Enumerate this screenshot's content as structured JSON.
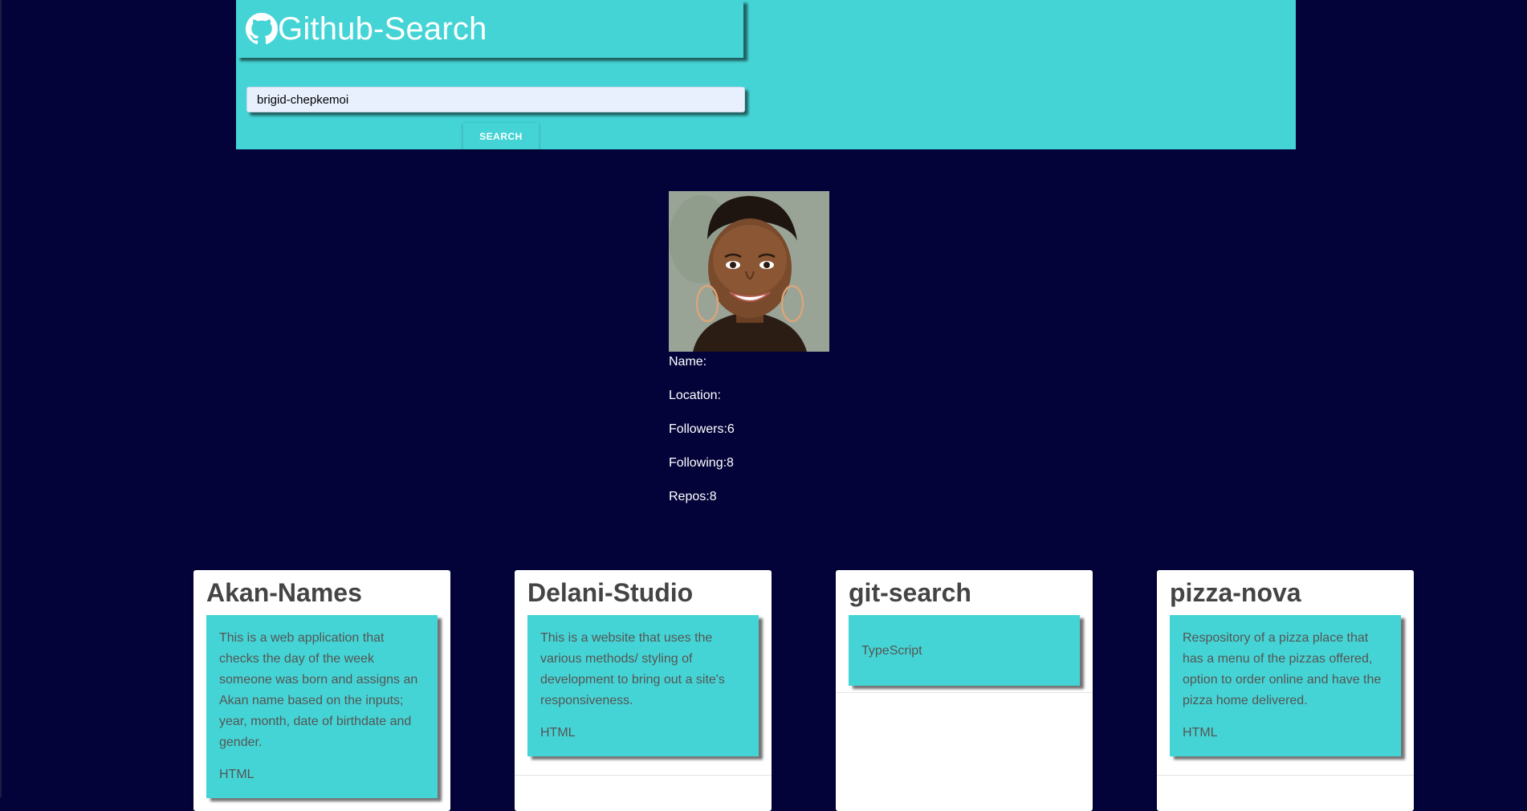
{
  "header": {
    "title": "Github-Search",
    "logo_icon": "github-icon",
    "search_value": "brigid-chepkemoi",
    "search_button_label": "SEARCH",
    "background": "#45d4d5"
  },
  "profile": {
    "avatar_icon": "user-avatar",
    "name_label": "Name:",
    "location_label": "Location:",
    "followers": "Followers:6",
    "following": "Following:8",
    "repos": "Repos:8"
  },
  "repos": [
    {
      "name": "Akan-Names",
      "description": "This is a web application that checks the day of the week someone was born and assigns an Akan name based on the inputs; year, month, date of birthdate and gender.",
      "language": "HTML"
    },
    {
      "name": "Delani-Studio",
      "description": "This is a website that uses the various methods/ styling of development to bring out a site's responsiveness.",
      "language": "HTML"
    },
    {
      "name": "git-search",
      "description": "",
      "language": "TypeScript"
    },
    {
      "name": "pizza-nova",
      "description": "Respository of a pizza place that has a menu of the pizzas offered, option to order online and have the pizza home delivered.",
      "language": "HTML"
    }
  ],
  "colors": {
    "page_background": "#03033a",
    "accent": "#45d4d5",
    "card_text": "#555555"
  }
}
